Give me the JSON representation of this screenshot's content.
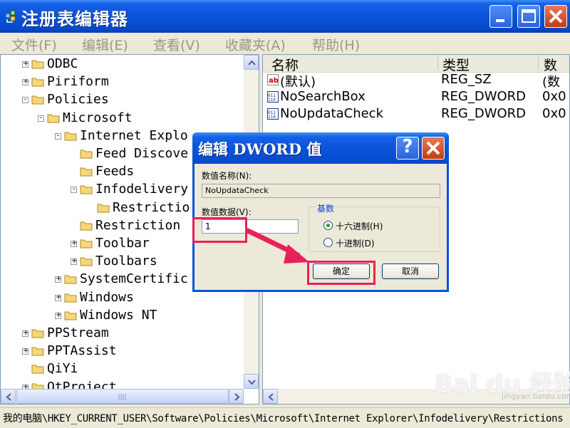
{
  "window": {
    "title": "注册表编辑器",
    "minimize": "minimize",
    "maximize": "maximize",
    "close": "close"
  },
  "menu": {
    "items": [
      "文件(F)",
      "编辑(E)",
      "查看(V)",
      "收藏夹(A)",
      "帮助(H)"
    ]
  },
  "tree": {
    "items": [
      {
        "label": "ODBC",
        "expander": "+"
      },
      {
        "label": "Piriform",
        "expander": "+"
      },
      {
        "label": "Policies",
        "expander": "-"
      },
      {
        "label": "Microsoft",
        "expander": "-"
      },
      {
        "label": "Internet Explo",
        "expander": "-"
      },
      {
        "label": "Feed Discove",
        "expander": ""
      },
      {
        "label": "Feeds",
        "expander": ""
      },
      {
        "label": "Infodelivery",
        "expander": "-"
      },
      {
        "label": "Restrictio",
        "expander": ""
      },
      {
        "label": "Restriction",
        "expander": ""
      },
      {
        "label": "Toolbar",
        "expander": "+"
      },
      {
        "label": "Toolbars",
        "expander": "+"
      },
      {
        "label": "SystemCertific",
        "expander": "+"
      },
      {
        "label": "Windows",
        "expander": "+"
      },
      {
        "label": "Windows NT",
        "expander": "+"
      },
      {
        "label": "PPStream",
        "expander": "+"
      },
      {
        "label": "PPTAssist",
        "expander": "+"
      },
      {
        "label": "QiYi",
        "expander": ""
      },
      {
        "label": "QtProject",
        "expander": "+"
      }
    ]
  },
  "list": {
    "headers": [
      "名称",
      "类型",
      "数"
    ],
    "rows": [
      {
        "icon": "string-value-icon",
        "name": "(默认)",
        "type": "REG_SZ",
        "data": "(数"
      },
      {
        "icon": "dword-value-icon",
        "name": "NoSearchBox",
        "type": "REG_DWORD",
        "data": "0x0"
      },
      {
        "icon": "dword-value-icon",
        "name": "NoUpdataCheck",
        "type": "REG_DWORD",
        "data": "0x0"
      }
    ]
  },
  "status": {
    "path": "我的电脑\\HKEY_CURRENT_USER\\Software\\Policies\\Microsoft\\Internet Explorer\\Infodelivery\\Restrictions"
  },
  "dialog": {
    "title": "编辑 DWORD 值",
    "help": "?",
    "name_label": "数值名称(N):",
    "name_value": "NoUpdataCheck",
    "data_label": "数值数据(V):",
    "data_value": "1",
    "base_label": "基数",
    "hex_label": "十六进制(H)",
    "dec_label": "十进制(D)",
    "selected_base": "hex",
    "ok": "确定",
    "cancel": "取消"
  },
  "watermark": {
    "brand": "Bai du 经验",
    "url": "jingyan.baidu.com"
  },
  "colors": {
    "titlebar": "#0a53d8",
    "highlight_annotation": "#e8205a",
    "folder": "#f5d77a"
  }
}
